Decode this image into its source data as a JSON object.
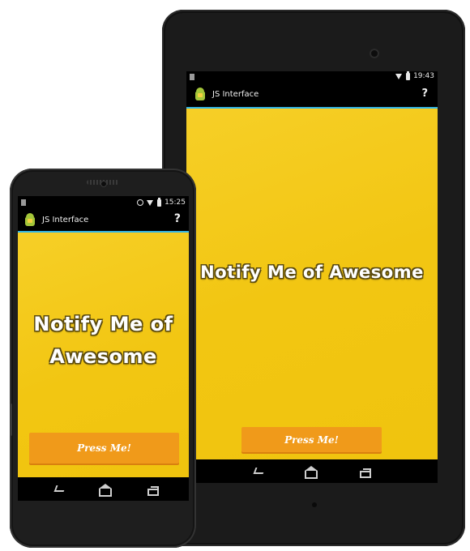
{
  "tablet": {
    "status": {
      "time": "19:43"
    },
    "actionbar": {
      "title": "JS Interface",
      "help": "?"
    },
    "content": {
      "headline": "Notify Me of Awesome",
      "button_label": "Press Me!"
    }
  },
  "phone": {
    "status": {
      "time": "15:25"
    },
    "actionbar": {
      "title": "JS Interface",
      "help": "?"
    },
    "content": {
      "headline": "Notify Me of Awesome",
      "button_label": "Press Me!"
    }
  },
  "colors": {
    "background": "#f2c612",
    "button": "#f09a1a",
    "accent_line": "#33b5e5",
    "android_green": "#a4c639"
  },
  "icons": {
    "status": [
      "notification-icon",
      "alarm-icon",
      "wifi-icon",
      "battery-icon"
    ],
    "nav": [
      "back-icon",
      "home-icon",
      "recent-apps-icon"
    ],
    "app": "android-app-icon"
  }
}
